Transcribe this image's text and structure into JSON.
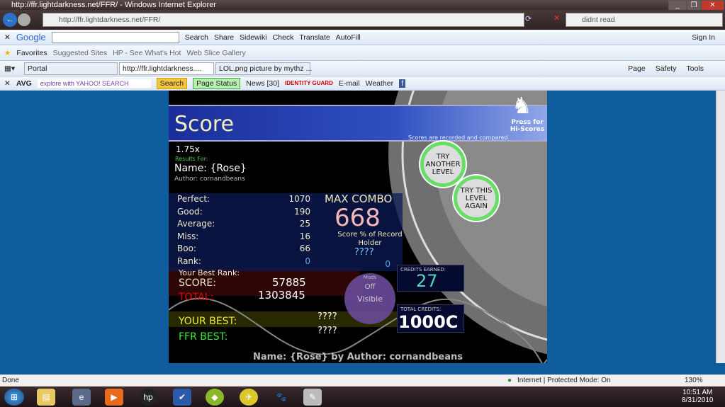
{
  "window": {
    "title": "http://ffr.lightdarkness.net/FFR/ - Windows Internet Explorer",
    "url": "http://ffr.lightdarkness.net/FFR/",
    "search_value": "didnt read"
  },
  "google_bar": {
    "brand": "Google",
    "search": "Search",
    "share": "Share",
    "sidewiki": "Sidewiki",
    "check": "Check",
    "translate": "Translate",
    "autofill": "AutoFill",
    "sign_in": "Sign In"
  },
  "favorites_bar": {
    "favorites": "Favorites",
    "items": [
      "Suggested Sites",
      "HP - See What's Hot",
      "Web Slice Gallery"
    ]
  },
  "tabs": [
    {
      "label": "Portal"
    },
    {
      "label": "http://ffr.lightdarkness....",
      "active": true
    },
    {
      "label": "LOL.png picture by mythz ..."
    }
  ],
  "command_bar": {
    "page": "Page",
    "safety": "Safety",
    "tools": "Tools"
  },
  "avg_bar": {
    "avg": "AVG",
    "yahoo_placeholder": "explore with YAHOO! SEARCH",
    "search": "Search",
    "page_status": "Page Status",
    "news": "News [30]",
    "identity_guard": "IDENTITY GUARD",
    "email": "E-mail",
    "weather": "Weather"
  },
  "game": {
    "title": "Score",
    "hiscores": "Press for Hi-Scores",
    "recorded": "Scores are recorded and compared",
    "speed": "1.75x",
    "results_for": "Results For:",
    "song_name": "Name: {Rose}",
    "author": "Author: cornandbeans",
    "try_another": "TRY ANOTHER LEVEL",
    "try_again": "TRY THIS LEVEL AGAIN",
    "stats": [
      {
        "label": "Perfect:",
        "value": "1070"
      },
      {
        "label": "Good:",
        "value": "190"
      },
      {
        "label": "Average:",
        "value": "25"
      },
      {
        "label": "Miss:",
        "value": "16"
      },
      {
        "label": "Boo:",
        "value": "66"
      },
      {
        "label": "Rank:",
        "value": "0"
      }
    ],
    "extra_zero": "0",
    "max_combo_label": "MAX COMBO",
    "max_combo": "668",
    "score_pct_label": "Score % of Record Holder",
    "score_pct": "????",
    "best_rank": "Your Best Rank:",
    "score_label": "SCORE:",
    "score": "57885",
    "total_label": "TOTAL:",
    "total": "1303845",
    "mods_label": "Mods",
    "mods_off": "Off",
    "mods_visible": "Visible",
    "credits_earned_label": "CREDITS EARNED:",
    "credits_earned": "27",
    "total_credits_label": "TOTAL CREDITS:",
    "total_credits": "1000C",
    "your_best_label": "YOUR BEST:",
    "your_best": "????",
    "ffr_best_label": "FFR BEST:",
    "ffr_best": "????",
    "footer": "Name: {Rose} by Author: cornandbeans"
  },
  "statusbar": {
    "left": "Done",
    "zone": "Internet | Protected Mode: On",
    "zoom": "130%"
  },
  "taskbar": {
    "time": "10:51 AM",
    "date": "8/31/2010"
  }
}
